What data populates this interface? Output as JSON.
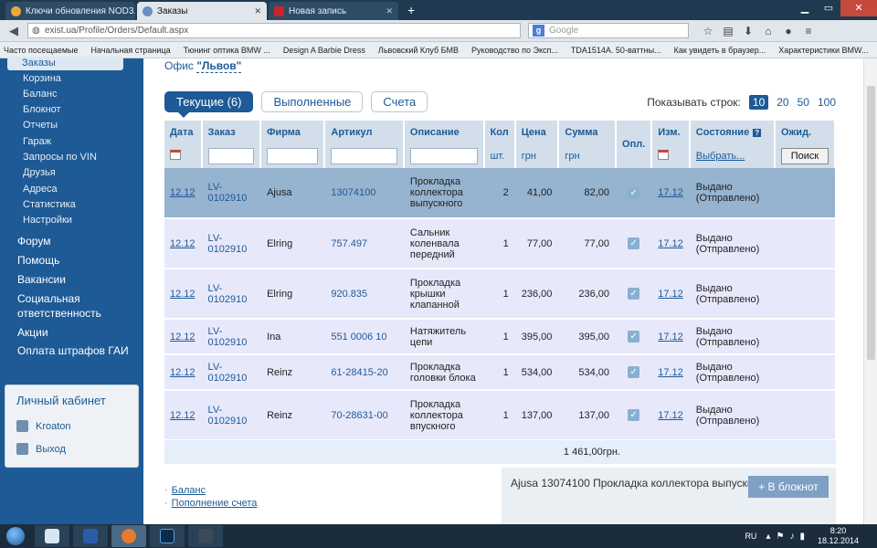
{
  "browser": {
    "tabs": [
      {
        "title": "Ключи обновления NOD3...",
        "color": "#e8a93a",
        "active": false
      },
      {
        "title": "Заказы",
        "color": "#6b8fc4",
        "active": true
      },
      {
        "title": "Новая запись",
        "color": "#c8262a",
        "active": false
      }
    ],
    "new_tab": "+",
    "url": "exist.ua/Profile/Orders/Default.aspx",
    "search_placeholder": "Google",
    "bookmarks": [
      "Часто посещаемые",
      "Начальная страница",
      "Тюнинг оптика BMW ...",
      "Design A Barbie Dress",
      "Львовский Клуб БМВ",
      "Руководство по Эксп...",
      "TDA1514A. 50-ваттны...",
      "Как увидеть в браузер...",
      "Характеристики BMW..."
    ]
  },
  "sidebar": {
    "active_item": "Заказы",
    "sub_items": [
      "Корзина",
      "Баланс",
      "Блокнот",
      "Отчеты",
      "Гараж",
      "Запросы по VIN",
      "Друзья",
      "Адреса",
      "Статистика",
      "Настройки"
    ],
    "main_items": [
      "Форум",
      "Помощь",
      "Вакансии",
      "Социальная ответственность",
      "Акции",
      "Оплата штрафов ГАИ"
    ],
    "cabinet": {
      "title": "Личный кабинет",
      "user": "Kroaton",
      "logout": "Выход"
    }
  },
  "page": {
    "office_prefix": "Офис",
    "office_name": "\"Львов\"",
    "tabs": [
      "Текущие (6)",
      "Выполненные",
      "Счета"
    ],
    "rows_label": "Показывать строк:",
    "rows_options": [
      "10",
      "20",
      "50",
      "100"
    ],
    "rows_selected": "10"
  },
  "table": {
    "headers": {
      "date": "Дата",
      "order": "Заказ",
      "firm": "Фирма",
      "article": "Артикул",
      "desc": "Описание",
      "qty": "Кол",
      "price": "Цена",
      "sum": "Сумма",
      "paid": "Опл.",
      "changed": "Изм.",
      "status": "Состояние",
      "wait": "Ожид."
    },
    "subheaders": {
      "qty": "шт.",
      "price": "грн",
      "sum": "грн",
      "choose": "Выбрать...",
      "search": "Поиск"
    },
    "rows": [
      {
        "date": "12.12",
        "order": "LV-0102910",
        "firm": "Ajusa",
        "article": "13074100",
        "desc": "Прокладка коллектора выпускного",
        "qty": "2",
        "price": "41,00",
        "sum": "82,00",
        "changed": "17.12",
        "status": "Выдано (Отправлено)"
      },
      {
        "date": "12.12",
        "order": "LV-0102910",
        "firm": "Elring",
        "article": "757.497",
        "desc": "Сальник коленвала передний",
        "qty": "1",
        "price": "77,00",
        "sum": "77,00",
        "changed": "17.12",
        "status": "Выдано (Отправлено)"
      },
      {
        "date": "12.12",
        "order": "LV-0102910",
        "firm": "Elring",
        "article": "920.835",
        "desc": "Прокладка крышки клапанной",
        "qty": "1",
        "price": "236,00",
        "sum": "236,00",
        "changed": "17.12",
        "status": "Выдано (Отправлено)"
      },
      {
        "date": "12.12",
        "order": "LV-0102910",
        "firm": "Ina",
        "article": "551 0006 10",
        "desc": "Натяжитель цепи",
        "qty": "1",
        "price": "395,00",
        "sum": "395,00",
        "changed": "17.12",
        "status": "Выдано (Отправлено)"
      },
      {
        "date": "12.12",
        "order": "LV-0102910",
        "firm": "Reinz",
        "article": "61-28415-20",
        "desc": "Прокладка головки блока",
        "qty": "1",
        "price": "534,00",
        "sum": "534,00",
        "changed": "17.12",
        "status": "Выдано (Отправлено)"
      },
      {
        "date": "12.12",
        "order": "LV-0102910",
        "firm": "Reinz",
        "article": "70-28631-00",
        "desc": "Прокладка коллектора впускного",
        "qty": "1",
        "price": "137,00",
        "sum": "137,00",
        "changed": "17.12",
        "status": "Выдано (Отправлено)"
      }
    ],
    "total": "1 461,00грн."
  },
  "footer": {
    "links": [
      "Баланс",
      "Пополнение счета"
    ],
    "selected_item": "Ajusa 13074100 Прокладка коллектора выпускного",
    "notebook_button": "+ В блокнот"
  },
  "taskbar": {
    "lang": "RU",
    "time": "8:20",
    "date": "18.12.2014"
  }
}
